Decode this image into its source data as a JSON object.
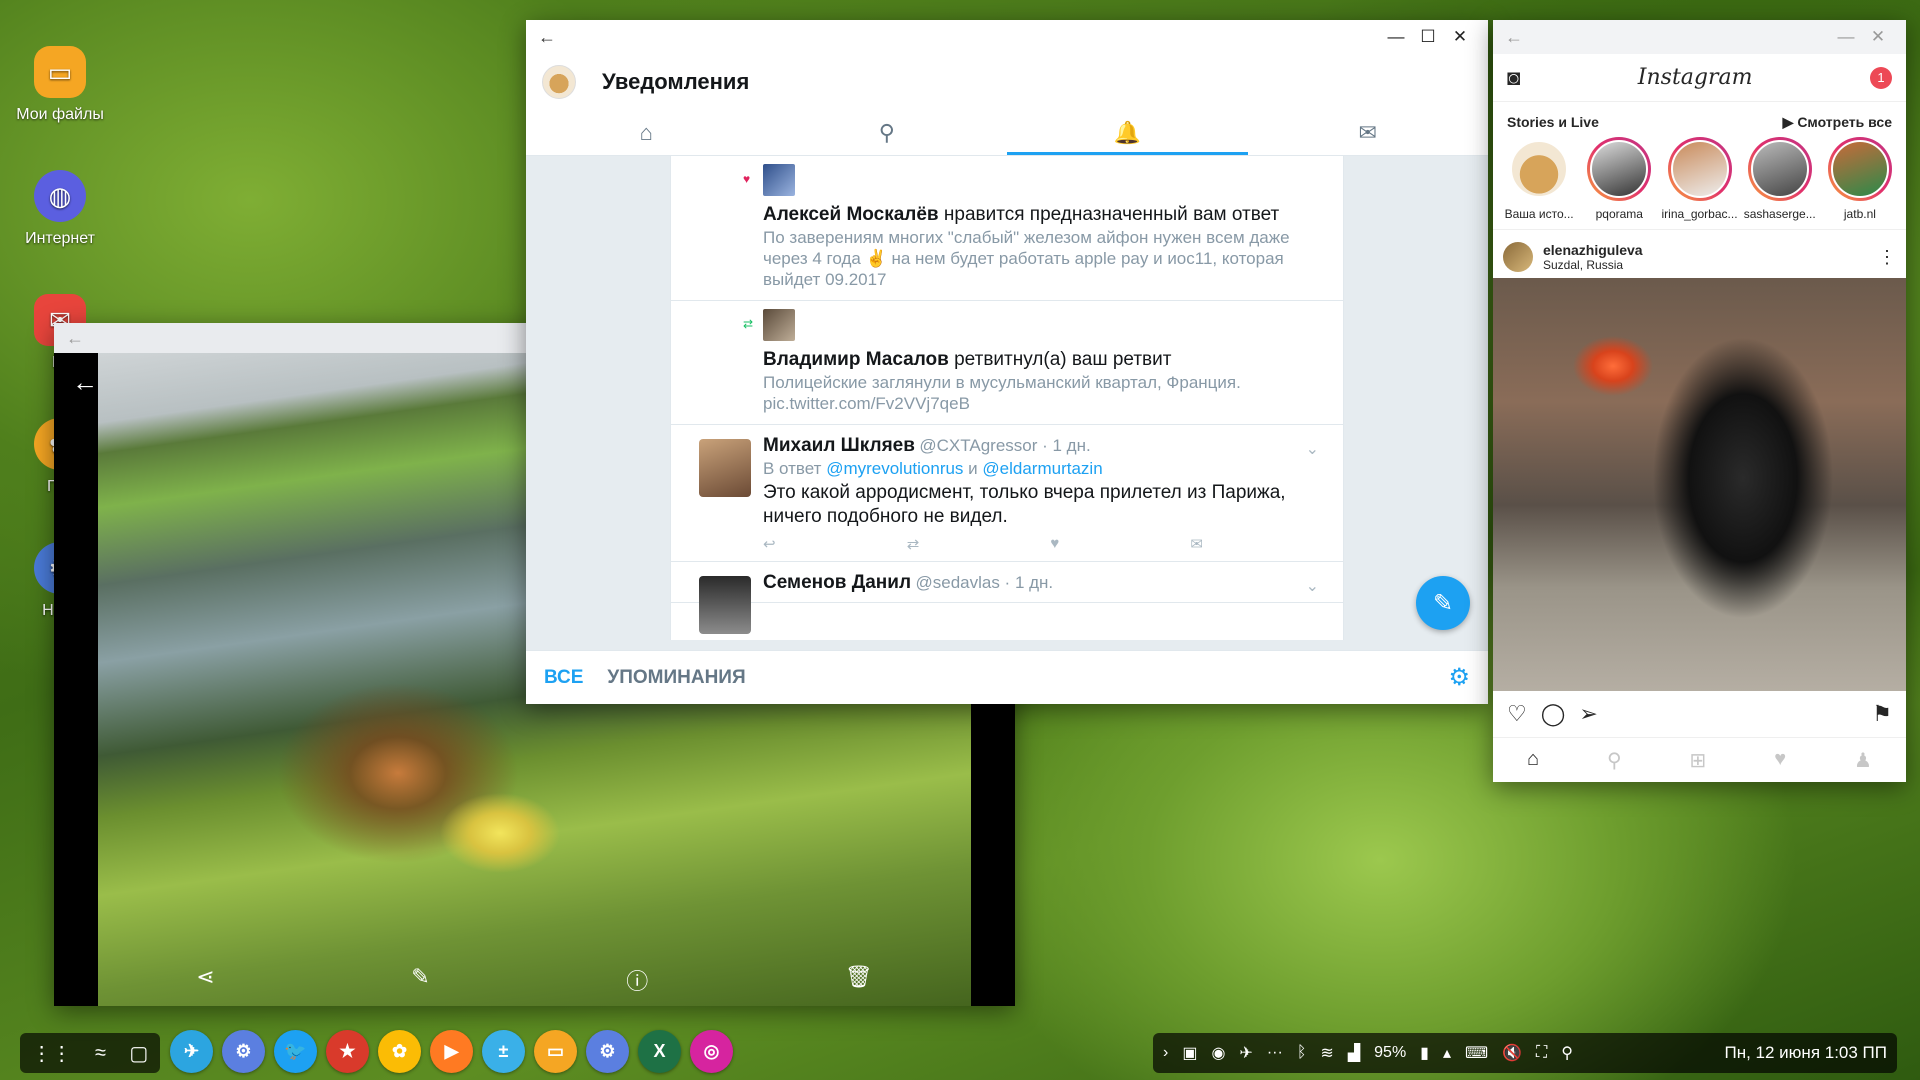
{
  "desktop": {
    "icons": [
      {
        "label": "Мои файлы",
        "color": "#f5a623",
        "glyph": "folder-icon"
      },
      {
        "label": "Интернет",
        "color": "#5b5fe0",
        "glyph": "planet-icon"
      },
      {
        "label": "E-",
        "color": "#e8453c",
        "glyph": "mail-icon"
      },
      {
        "label": "Гал",
        "color": "#f5a623",
        "glyph": "gallery-icon"
      },
      {
        "label": "Наст",
        "color": "#4a7bd8",
        "glyph": "settings-icon"
      }
    ]
  },
  "gallery": {
    "toolbar": [
      "share-icon",
      "edit-icon",
      "info-icon",
      "delete-icon"
    ]
  },
  "twitter": {
    "title": "Уведомления",
    "tabs": [
      "home-icon",
      "search-icon",
      "bell-icon",
      "mail-icon"
    ],
    "active_tab": 2,
    "notifications": [
      {
        "type": "like",
        "actor": "Алексей Москалёв",
        "action": "нравится предназначенный вам ответ",
        "text": "По заверениям многих \"слабый\" железом айфон нужен всем даже через 4 года ✌ на нем будет работать apple pay и иос11, которая выйдет 09.2017"
      },
      {
        "type": "retweet",
        "actor": "Владимир Масалов",
        "action": "ретвитнул(а) ваш ретвит",
        "text": "Полицейские заглянули в мусульманский квартал, Франция. pic.twitter.com/Fv2VVj7qeB"
      }
    ],
    "tweets": [
      {
        "name": "Михаил Шкляев",
        "handle": "@CXTAgressor · 1 дн.",
        "reply_prefix": "В ответ",
        "reply_to_1": "@myrevolutionrus",
        "reply_and": "и",
        "reply_to_2": "@eldarmurtazin",
        "text": "Это какой арродисмент, только вчера прилетел из Парижа, ничего подобного не видел."
      },
      {
        "name": "Семенов Данил",
        "handle": "@sedavlas · 1 дн."
      }
    ],
    "bottom_tabs": {
      "all": "ВСЕ",
      "mentions": "УПОМИНАНИЯ"
    }
  },
  "instagram": {
    "logo": "Instagram",
    "badge": "1",
    "stories_title": "Stories и Live",
    "see_all": "▶ Смотреть все",
    "stories": [
      "Ваша исто...",
      "pqorama",
      "irina_gorbac...",
      "sashaserge...",
      "jatb.nl"
    ],
    "post": {
      "user": "elenazhiguleva",
      "location": "Suzdal, Russia"
    }
  },
  "taskbar": {
    "apps": [
      {
        "name": "telegram",
        "color": "#2ca5e0",
        "glyph": "✈"
      },
      {
        "name": "settings",
        "color": "#5b7fe0",
        "glyph": "⚙"
      },
      {
        "name": "twitter",
        "color": "#1da1f2",
        "glyph": "🐦"
      },
      {
        "name": "wunderlist",
        "color": "#d93a2b",
        "glyph": "★"
      },
      {
        "name": "photos",
        "color": "#fbbc05",
        "glyph": "✿"
      },
      {
        "name": "play-music",
        "color": "#ff7a22",
        "glyph": "▶"
      },
      {
        "name": "calculator",
        "color": "#3ab0e8",
        "glyph": "±"
      },
      {
        "name": "my-files",
        "color": "#f5a623",
        "glyph": "▭"
      },
      {
        "name": "settings-2",
        "color": "#5b7fe0",
        "glyph": "⚙"
      },
      {
        "name": "excel",
        "color": "#1e7145",
        "glyph": "X"
      },
      {
        "name": "instagram",
        "color": "#d6249f",
        "glyph": "◎"
      }
    ],
    "battery": "95%",
    "clock": "Пн, 12 июня 1:03 ПП"
  }
}
